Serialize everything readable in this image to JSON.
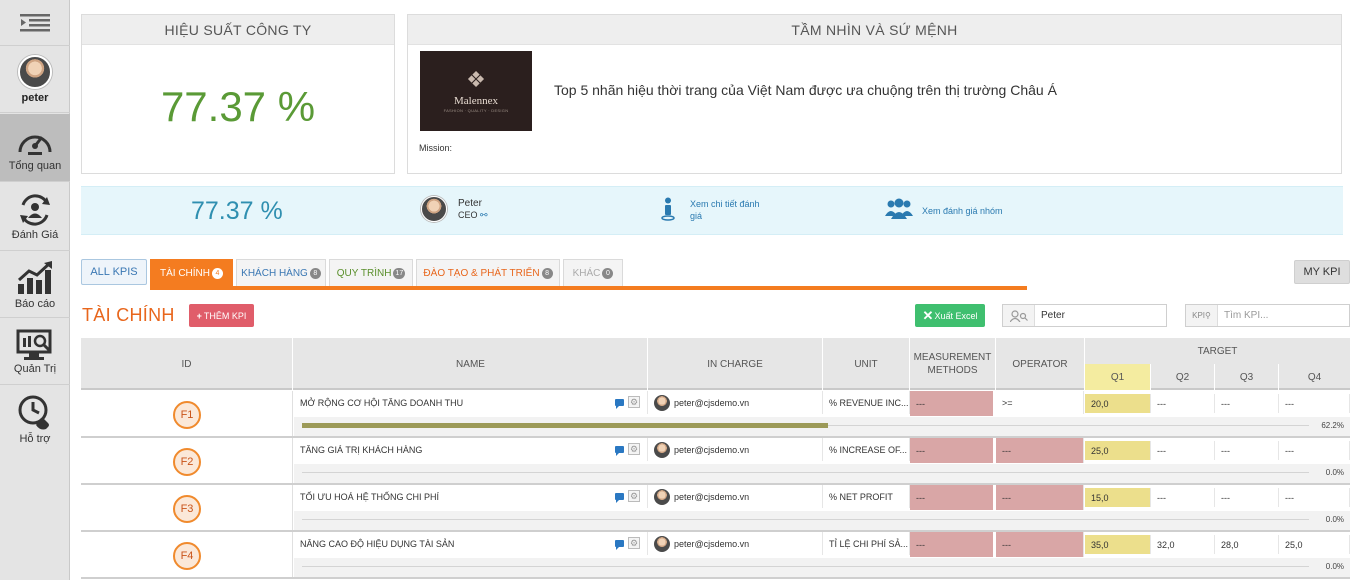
{
  "user": {
    "name": "peter"
  },
  "sidebar": {
    "items": [
      {
        "label": "Tổng quan",
        "icon": "dashboard-gauge-icon"
      },
      {
        "label": "Đánh Giá",
        "icon": "user-cycle-icon"
      },
      {
        "label": "Báo cáo",
        "icon": "bar-chart-icon"
      },
      {
        "label": "Quản Trị",
        "icon": "monitor-search-icon"
      },
      {
        "label": "Hỗ trợ",
        "icon": "clock-phone-icon"
      }
    ]
  },
  "company_performance": {
    "title": "HIỆU SUẤT CÔNG TY",
    "value": "77.37 %"
  },
  "vision": {
    "title": "TẦM NHÌN VÀ SỨ MỆNH",
    "logo_name": "Malennex",
    "logo_tagline": "FASHION · QUALITY · DESIGN",
    "text": "Top 5 nhãn hiệu thời trang của Việt Nam được ưa chuộng trên thị trường Châu Á",
    "mission_label": "Mission:"
  },
  "summary": {
    "value": "77.37 %",
    "person_name": "Peter",
    "person_role": "CEO",
    "detail_link": "Xem chi tiết đánh giá",
    "group_link": "Xem đánh giá nhóm"
  },
  "tabs": {
    "all": "ALL KPIS",
    "items": [
      {
        "label": "TÀI CHÍNH",
        "count": "4",
        "color": "#ffffff"
      },
      {
        "label": "KHÁCH HÀNG",
        "count": "8",
        "color": "#3a77b3"
      },
      {
        "label": "QUY TRÌNH",
        "count": "17",
        "color": "#5a8f2c"
      },
      {
        "label": "ĐÀO TẠO & PHÁT TRIỂN",
        "count": "8",
        "color": "#e8661c"
      },
      {
        "label": "KHÁC",
        "count": "0",
        "color": "#aaaaaa"
      }
    ],
    "my_kpi": "MY KPI"
  },
  "section": {
    "title": "TÀI CHÍNH",
    "add_button": "THÊM KPI",
    "excel_button": "Xuất Excel",
    "person_filter_value": "Peter",
    "kpi_search_prefix": "KPI",
    "kpi_search_placeholder": "Tìm KPI..."
  },
  "table": {
    "headers": {
      "id": "ID",
      "name": "NAME",
      "in_charge": "IN CHARGE",
      "unit": "UNIT",
      "measurement": "MEASUREMENT METHODS",
      "operator": "OPERATOR",
      "target": "TARGET",
      "q1": "Q1",
      "q2": "Q2",
      "q3": "Q3",
      "q4": "Q4"
    },
    "rows": [
      {
        "id": "F1",
        "name": "MỞ RỘNG CƠ HỘI TĂNG DOANH THU",
        "in_charge": "peter@cjsdemo.vn",
        "unit": "% REVENUE INC...",
        "measurement": "---",
        "operator": ">=",
        "q1": "20,0",
        "q2": "---",
        "q3": "---",
        "q4": "---",
        "progress": 62.2,
        "progress_label": "62.2%"
      },
      {
        "id": "F2",
        "name": "TĂNG GIÁ TRỊ KHÁCH HÀNG",
        "in_charge": "peter@cjsdemo.vn",
        "unit": "% INCREASE OF...",
        "measurement": "---",
        "operator": "---",
        "q1": "25,0",
        "q2": "---",
        "q3": "---",
        "q4": "---",
        "progress": 0,
        "progress_label": "0.0%"
      },
      {
        "id": "F3",
        "name": "TỐI ƯU HOÁ HỆ THỐNG CHI PHÍ",
        "in_charge": "peter@cjsdemo.vn",
        "unit": "% NET PROFIT",
        "measurement": "---",
        "operator": "---",
        "q1": "15,0",
        "q2": "---",
        "q3": "---",
        "q4": "---",
        "progress": 0,
        "progress_label": "0.0%"
      },
      {
        "id": "F4",
        "name": "NÂNG CAO ĐỘ HIỆU DỤNG TÀI SẢN",
        "in_charge": "peter@cjsdemo.vn",
        "unit": "TỈ LỆ CHI PHÍ SẢ...",
        "measurement": "---",
        "operator": "---",
        "q1": "35,0",
        "q2": "32,0",
        "q3": "28,0",
        "q4": "25,0",
        "progress": 0,
        "progress_label": "0.0%"
      }
    ]
  }
}
